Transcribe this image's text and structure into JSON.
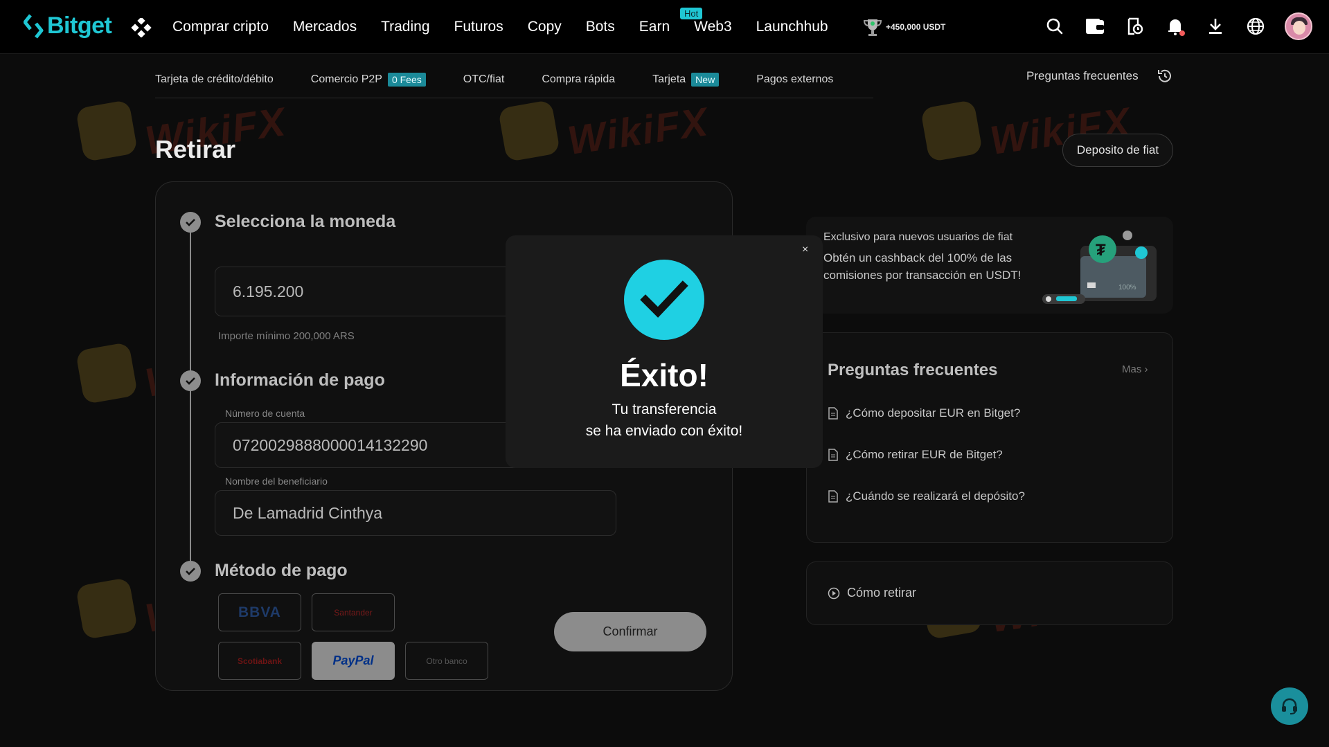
{
  "brand": {
    "name": "Bitget",
    "accent": "#1fc7d4"
  },
  "nav": {
    "items": [
      "Comprar cripto",
      "Mercados",
      "Trading",
      "Futuros",
      "Copy",
      "Bots",
      "Earn",
      "Web3",
      "Launchhub"
    ],
    "hot_badge": "Hot",
    "promo": "+450,000 USDT",
    "icons": [
      "search-icon",
      "wallet-icon",
      "orders-icon",
      "bell-icon",
      "download-icon",
      "globe-icon"
    ]
  },
  "subnav": {
    "items": [
      {
        "label": "Tarjeta de crédito/débito",
        "tag": ""
      },
      {
        "label": "Comercio P2P",
        "tag": "0 Fees"
      },
      {
        "label": "OTC/fiat",
        "tag": ""
      },
      {
        "label": "Compra rápida",
        "tag": ""
      },
      {
        "label": "Tarjeta",
        "tag": "New"
      },
      {
        "label": "Pagos externos",
        "tag": ""
      }
    ],
    "faq": "Preguntas frecuentes"
  },
  "page": {
    "title": "Retirar",
    "deposit_fiat": "Deposito de fiat"
  },
  "form": {
    "step1": "Selecciona la moneda",
    "amount": "6.195.200",
    "min_hint": "Importe mínimo 200,000 ARS",
    "step2": "Información de pago",
    "account_label": "Número de cuenta",
    "account_value": "0720029888000014132290",
    "beneficiary_label": "Nombre del beneficiario",
    "beneficiary_value": "De Lamadrid Cinthya",
    "step3": "Método de pago",
    "methods": [
      "BBVA",
      "Santander",
      "Scotiabank",
      "PayPal",
      "Otro banco"
    ],
    "confirm": "Confirmar"
  },
  "promo": {
    "line1": "Exclusivo para nuevos usuarios de fiat",
    "body": "Obtén un cashback del 100% de las comisiones por transacción en USDT!",
    "card_text": "100%"
  },
  "faq": {
    "title": "Preguntas frecuentes",
    "more": "Mas",
    "items": [
      "¿Cómo depositar EUR en Bitget?",
      "¿Cómo retirar EUR de Bitget?",
      "¿Cuándo se realizará el depósito?"
    ]
  },
  "howto": {
    "label": "Cómo retirar"
  },
  "modal": {
    "close": "×",
    "title": "Éxito!",
    "message_line1": "Tu transferencia",
    "message_line2": "se ha enviado con éxito!"
  },
  "watermark": "WikiFX"
}
